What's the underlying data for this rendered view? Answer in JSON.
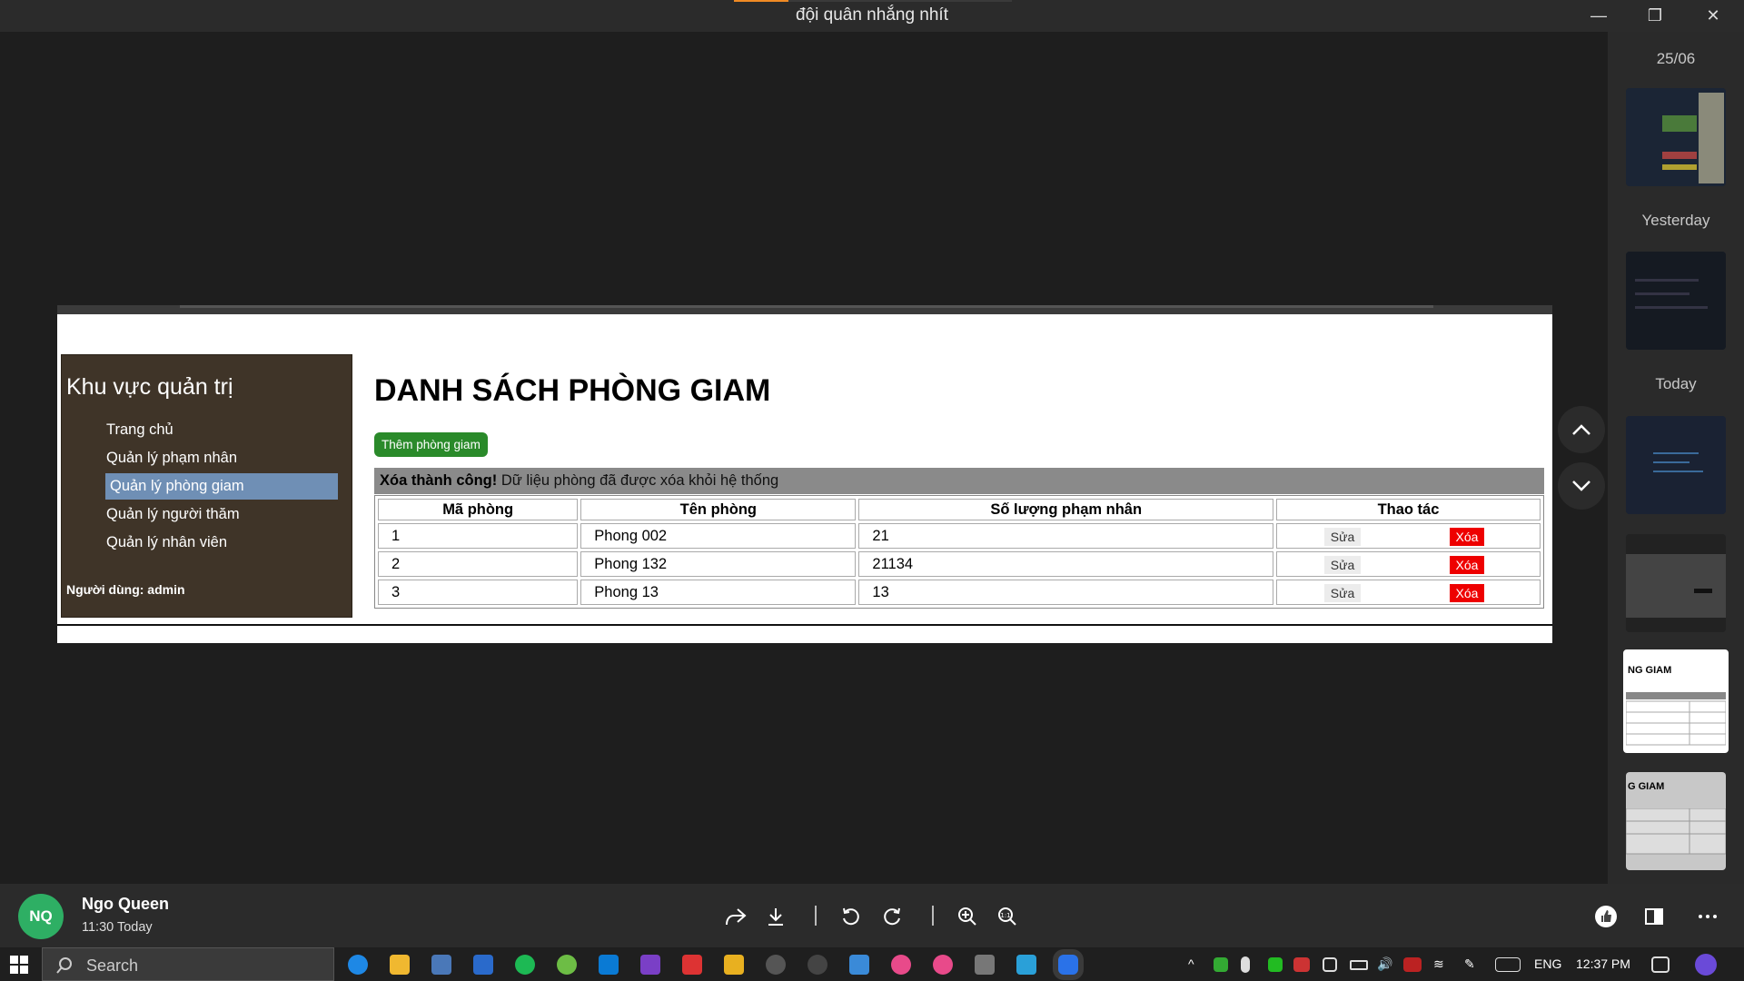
{
  "window": {
    "title": "đội quân nhắng nhít",
    "minimize_glyph": "—",
    "restore_glyph": "❐",
    "close_glyph": "✕"
  },
  "admin_page": {
    "sidebar": {
      "title": "Khu vực quản trị",
      "items": [
        {
          "label": "Trang chủ"
        },
        {
          "label": "Quản lý phạm nhân"
        },
        {
          "label": "Quản lý phòng giam"
        },
        {
          "label": "Quản lý người thăm"
        },
        {
          "label": "Quản lý nhân viên"
        }
      ],
      "user_text": "Người dùng: admin"
    },
    "heading": "DANH SÁCH PHÒNG GIAM",
    "add_button": "Thêm phòng giam",
    "alert": {
      "strong": "Xóa thành công!",
      "text": " Dữ liệu phòng đã được xóa khỏi hệ thống"
    },
    "table": {
      "headers": [
        "Mã phòng",
        "Tên phòng",
        "Số lượng phạm nhân",
        "Thao tác"
      ],
      "rows": [
        {
          "id": "1",
          "name": "Phong 002",
          "count": "21"
        },
        {
          "id": "2",
          "name": "Phong 132",
          "count": "21134"
        },
        {
          "id": "3",
          "name": "Phong 13",
          "count": "13"
        }
      ],
      "edit_label": "Sửa",
      "delete_label": "Xóa"
    }
  },
  "right_panel": {
    "date_label": "25/06",
    "yesterday_label": "Yesterday",
    "today_label": "Today",
    "thumb_sel_text": "NG GIAM",
    "thumb_last_text": "G GIAM"
  },
  "bottom": {
    "avatar_initials": "NQ",
    "user_name": "Ngo Queen",
    "time": "11:30 Today"
  },
  "taskbar": {
    "search_placeholder": "Search",
    "lang": "ENG",
    "clock": "12:37 PM"
  },
  "colors": {
    "sidebar_bg": "#3f3428",
    "active_item": "#6f8fb5",
    "add_button": "#2a8a2a",
    "delete_button": "#e00000",
    "avatar": "#2eaf64"
  }
}
